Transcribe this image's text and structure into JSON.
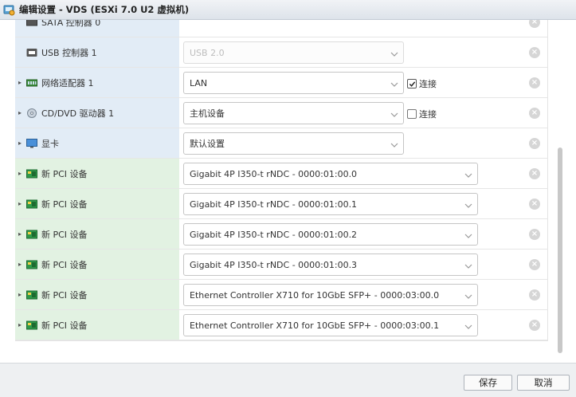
{
  "window": {
    "title": "编辑设置 - VDS (ESXi 7.0 U2 虚拟机)"
  },
  "rows": [
    {
      "label": "SATA 控制器 0",
      "type": "sata",
      "expand": false
    },
    {
      "label": "USB 控制器 1",
      "type": "usb",
      "expand": false,
      "value": "USB 2.0",
      "disabled": true
    },
    {
      "label": "网络适配器 1",
      "type": "net",
      "expand": true,
      "value": "LAN",
      "checkbox": {
        "label": "连接",
        "checked": true
      }
    },
    {
      "label": "CD/DVD 驱动器 1",
      "type": "cd",
      "expand": true,
      "value": "主机设备",
      "checkbox": {
        "label": "连接",
        "checked": false
      }
    },
    {
      "label": "显卡",
      "type": "display",
      "expand": true,
      "value": "默认设置"
    },
    {
      "label": "新 PCI 设备",
      "type": "pci",
      "expand": true,
      "value": "Gigabit 4P I350-t rNDC - 0000:01:00.0"
    },
    {
      "label": "新 PCI 设备",
      "type": "pci",
      "expand": true,
      "value": "Gigabit 4P I350-t rNDC - 0000:01:00.1"
    },
    {
      "label": "新 PCI 设备",
      "type": "pci",
      "expand": true,
      "value": "Gigabit 4P I350-t rNDC - 0000:01:00.2"
    },
    {
      "label": "新 PCI 设备",
      "type": "pci",
      "expand": true,
      "value": "Gigabit 4P I350-t rNDC - 0000:01:00.3"
    },
    {
      "label": "新 PCI 设备",
      "type": "pci",
      "expand": true,
      "value": "Ethernet Controller X710 for 10GbE SFP+ - 0000:03:00.0"
    },
    {
      "label": "新 PCI 设备",
      "type": "pci",
      "expand": true,
      "value": "Ethernet Controller X710 for 10GbE SFP+ - 0000:03:00.1"
    }
  ],
  "footer": {
    "save_label": "保存",
    "cancel_label": "取消"
  },
  "colors": {
    "label_bg": "#e2ecf6",
    "pci_label_bg": "#e2f2e2",
    "footer_bg": "#eef0f2"
  }
}
